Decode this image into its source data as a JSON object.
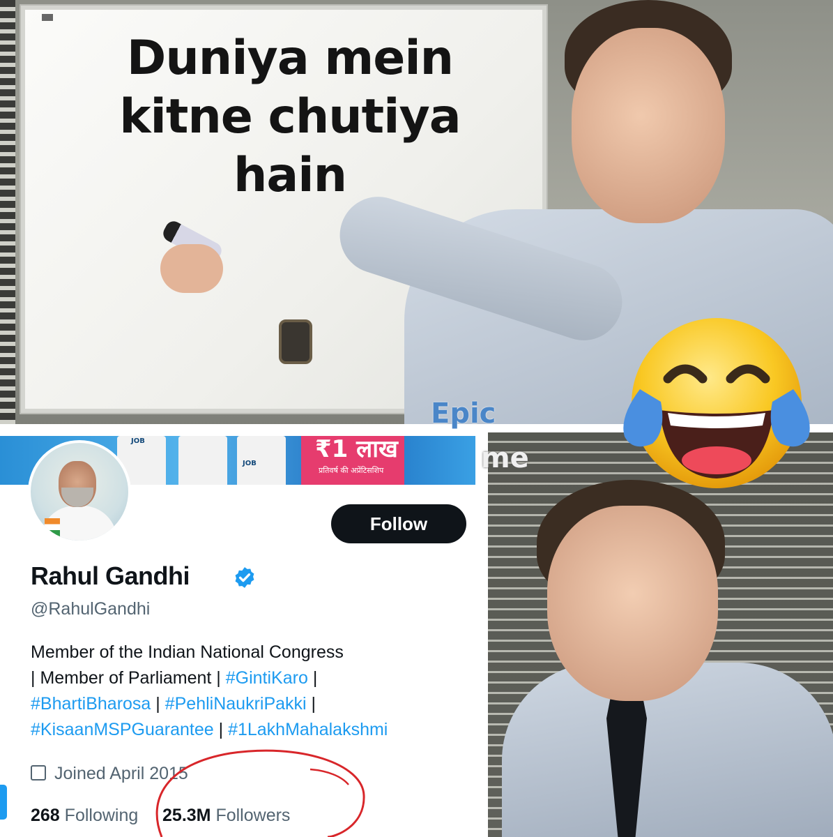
{
  "meme_top": {
    "board_text": "Duniya mein kitne chutiya hain"
  },
  "overlay": {
    "word1": "Epic",
    "word2": "me"
  },
  "emoji": {
    "icon": "face-with-tears-of-joy-icon"
  },
  "profile_card": {
    "banner": {
      "hindi_amount": "₹1 लाख",
      "hindi_subtitle": "प्रतिवर्ष की अप्रेंटिसशिप",
      "sign": "JOB"
    },
    "follow_label": "Follow",
    "name": "Rahul Gandhi",
    "handle": "@RahulGandhi",
    "bio": {
      "text1": "Member of the Indian National Congress",
      "text2": "| Member of Parliament | ",
      "tag1": "#GintiKaro",
      "sep1": " |",
      "tag2": "#BhartiBharosa",
      "sep2": " | ",
      "tag3": "#PehliNaukriPakki",
      "sep3": " |",
      "tag4": "#KisaanMSPGuarantee",
      "sep4": " | ",
      "tag5": "#1LakhMahalakshmi"
    },
    "joined": "Joined April 2015",
    "following_count": "268",
    "following_label": "Following",
    "followers_count": "25.3M",
    "followers_label": "Followers"
  },
  "colors": {
    "follow_bg": "#0f1419",
    "link": "#1d9bf0",
    "verified": "#1d9bf0",
    "annotation": "#d8262a"
  }
}
